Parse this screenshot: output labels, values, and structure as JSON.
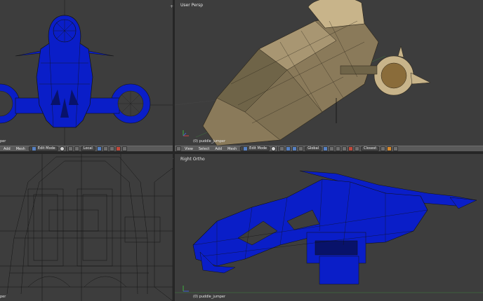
{
  "viewports": {
    "top_left": {
      "cut_label": "per"
    },
    "top_right": {
      "label": "User Persp",
      "object_name": "(0) puddle_jumper"
    },
    "bottom_left": {
      "cut_label": "per"
    },
    "bottom_right": {
      "label": "Right Ortho",
      "object_name": "(0) puddle_jumper"
    }
  },
  "header_left": {
    "menu_add": "Add",
    "menu_mesh": "Mesh",
    "mode": "Edit Mode",
    "orientation": "Local"
  },
  "header_right": {
    "menu_view": "View",
    "menu_select": "Select",
    "menu_add": "Add",
    "menu_mesh": "Mesh",
    "mode": "Edit Mode",
    "orientation": "Global",
    "snap": "Closest"
  },
  "icons": {
    "corner_top": "plus-icon",
    "corner_bottom": "plus-icon",
    "axis": "axis-gizmo-icon"
  },
  "colors": {
    "mesh_blue": "#0a1ec8",
    "mesh_dark_blue": "#08126a",
    "hull_tan": "#8a7a5a",
    "hull_light": "#c8b48a",
    "viewport_bg": "#3d3d3d",
    "header_bg": "#5a5a5a"
  }
}
